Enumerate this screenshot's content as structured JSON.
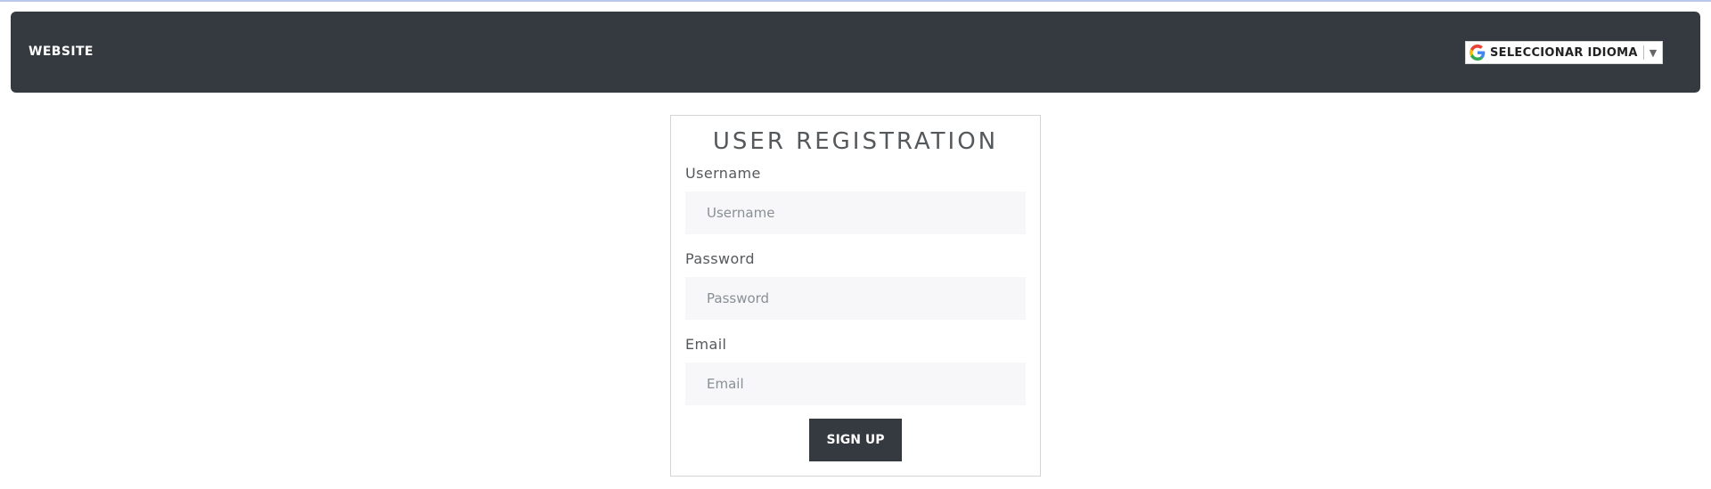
{
  "navbar": {
    "brand": "WEBSITE",
    "translate": {
      "label": "SELECCIONAR IDIOMA",
      "arrow": "▼",
      "icon": "google-g-icon"
    }
  },
  "form": {
    "title": "USER REGISTRATION",
    "fields": [
      {
        "label": "Username",
        "placeholder": "Username",
        "value": ""
      },
      {
        "label": "Password",
        "placeholder": "Password",
        "value": ""
      },
      {
        "label": "Email",
        "placeholder": "Email",
        "value": ""
      }
    ],
    "submit_label": "SIGN UP"
  },
  "colors": {
    "navbar_bg": "#343a40",
    "button_bg": "#343a40",
    "input_bg": "#f7f7f9",
    "text": "#55595c"
  }
}
